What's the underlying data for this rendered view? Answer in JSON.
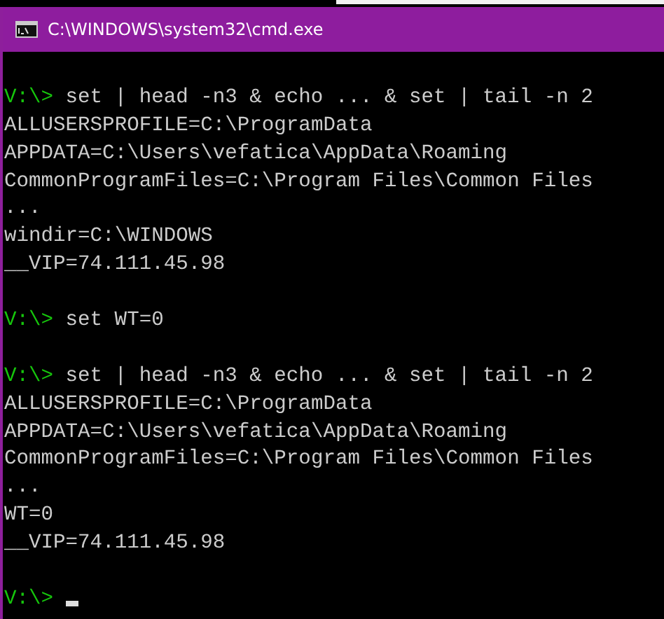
{
  "window": {
    "title": "C:\\WINDOWS\\system32\\cmd.exe"
  },
  "console": {
    "lines": [
      {
        "kind": "blank"
      },
      {
        "kind": "prompt",
        "prompt": "V:\\>",
        "command": "set | head -n3 & echo ... & set | tail -n 2"
      },
      {
        "kind": "output",
        "text": "ALLUSERSPROFILE=C:\\ProgramData"
      },
      {
        "kind": "output",
        "text": "APPDATA=C:\\Users\\vefatica\\AppData\\Roaming"
      },
      {
        "kind": "output",
        "text": "CommonProgramFiles=C:\\Program Files\\Common Files"
      },
      {
        "kind": "output",
        "text": "..."
      },
      {
        "kind": "output",
        "text": "windir=C:\\WINDOWS"
      },
      {
        "kind": "output",
        "text": "__VIP=74.111.45.98"
      },
      {
        "kind": "blank"
      },
      {
        "kind": "prompt",
        "prompt": "V:\\>",
        "command": "set WT=0"
      },
      {
        "kind": "blank"
      },
      {
        "kind": "prompt",
        "prompt": "V:\\>",
        "command": "set | head -n3 & echo ... & set | tail -n 2"
      },
      {
        "kind": "output",
        "text": "ALLUSERSPROFILE=C:\\ProgramData"
      },
      {
        "kind": "output",
        "text": "APPDATA=C:\\Users\\vefatica\\AppData\\Roaming"
      },
      {
        "kind": "output",
        "text": "CommonProgramFiles=C:\\Program Files\\Common Files"
      },
      {
        "kind": "output",
        "text": "..."
      },
      {
        "kind": "output",
        "text": "WT=0"
      },
      {
        "kind": "output",
        "text": "__VIP=74.111.45.98"
      },
      {
        "kind": "blank"
      },
      {
        "kind": "prompt",
        "prompt": "V:\\>",
        "cursor": true
      }
    ]
  }
}
